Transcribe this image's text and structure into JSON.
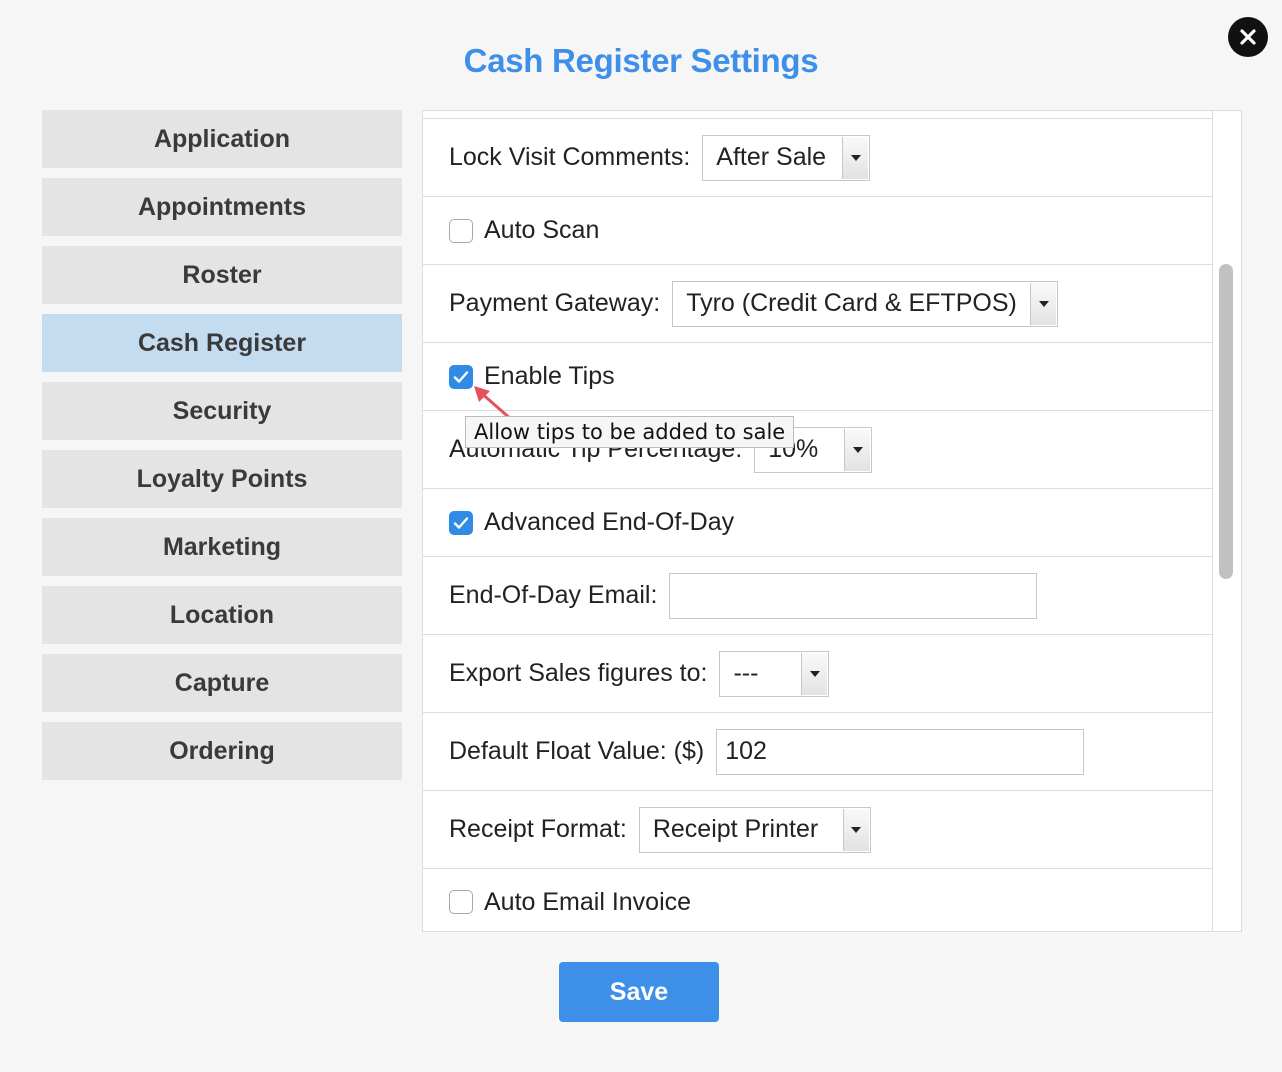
{
  "window": {
    "title": "Cash Register Settings",
    "close_icon": "close-icon"
  },
  "sidebar": {
    "items": [
      {
        "label": "Application",
        "active": false
      },
      {
        "label": "Appointments",
        "active": false
      },
      {
        "label": "Roster",
        "active": false
      },
      {
        "label": "Cash Register",
        "active": true
      },
      {
        "label": "Security",
        "active": false
      },
      {
        "label": "Loyalty Points",
        "active": false
      },
      {
        "label": "Marketing",
        "active": false
      },
      {
        "label": "Location",
        "active": false
      },
      {
        "label": "Capture",
        "active": false
      },
      {
        "label": "Ordering",
        "active": false
      }
    ]
  },
  "settings": {
    "lock_visit_comments": {
      "label": "Lock Visit Comments:",
      "value": "After Sale"
    },
    "auto_scan": {
      "label": "Auto Scan",
      "checked": false
    },
    "payment_gateway": {
      "label": "Payment Gateway:",
      "value": "Tyro (Credit Card & EFTPOS)"
    },
    "enable_tips": {
      "label": "Enable Tips",
      "checked": true
    },
    "automatic_tip_percentage": {
      "label": "Automatic Tip Percentage:",
      "value": "10%"
    },
    "advanced_end_of_day": {
      "label": "Advanced End-Of-Day",
      "checked": true
    },
    "end_of_day_email": {
      "label": "End-Of-Day Email:",
      "value": ""
    },
    "export_sales_figures": {
      "label": "Export Sales figures to:",
      "value": "---"
    },
    "default_float_value": {
      "label": "Default Float Value: ($)",
      "value": "102"
    },
    "receipt_format": {
      "label": "Receipt Format:",
      "value": "Receipt Printer"
    },
    "auto_email_invoice": {
      "label": "Auto Email Invoice",
      "checked": false
    }
  },
  "tooltip": {
    "text": "Allow tips to be added to sale"
  },
  "footer": {
    "save_label": "Save"
  },
  "colors": {
    "accent": "#3d8fe8",
    "active_nav": "#c4dcf0",
    "checkbox_checked": "#2f8be6",
    "annotation_arrow": "#e8505b"
  }
}
